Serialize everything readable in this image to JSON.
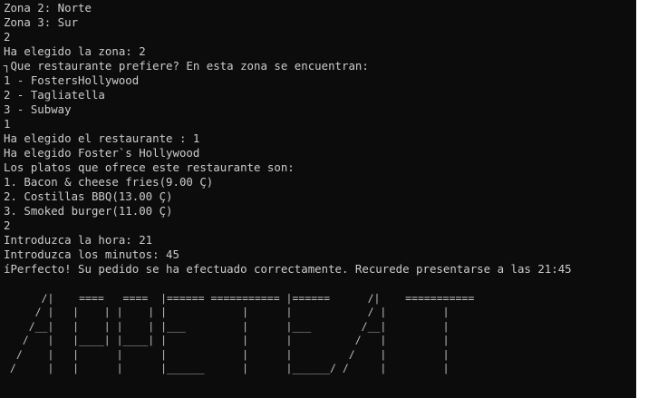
{
  "console": {
    "lines": [
      "Zona 2: Norte",
      "Zona 3: Sur",
      "2",
      "Ha elegido la zona: 2",
      "┐Que restaurante prefiere? En esta zona se encuentran:",
      "1 - FostersHollywood",
      "2 - Tagliatella",
      "3 - Subway",
      "1",
      "Ha elegido el restaurante : 1",
      "Ha elegido Foster`s Hollywood",
      "Los platos que ofrece este restaurante son:",
      "1. Bacon & cheese fries(9.00 Ç)",
      "2. Costillas BBQ(13.00 Ç)",
      "3. Smoked burger(11.00 Ç)",
      "2",
      "Introduzca la hora: 21",
      "Introduzca los minutos: 45",
      "íPerfecto! Su pedido se ha efectuado correctamente. Recurede presentarse a las 21:45"
    ],
    "ascii_art": [
      "",
      "      /|    ====   ====  |====== =========== |======      /|    ===========",
      "     / |   |    | |    | |            |      |            / |         |",
      "    /__|   |    | |    | |___         |      |___        /__|         |",
      "   /   |   |____| |____| |            |      |          /   |         |",
      "  /    |   |      |      |            |      |         /    |         |",
      " /     |   |      |      |______      |      |______/ /     |         |"
    ]
  }
}
